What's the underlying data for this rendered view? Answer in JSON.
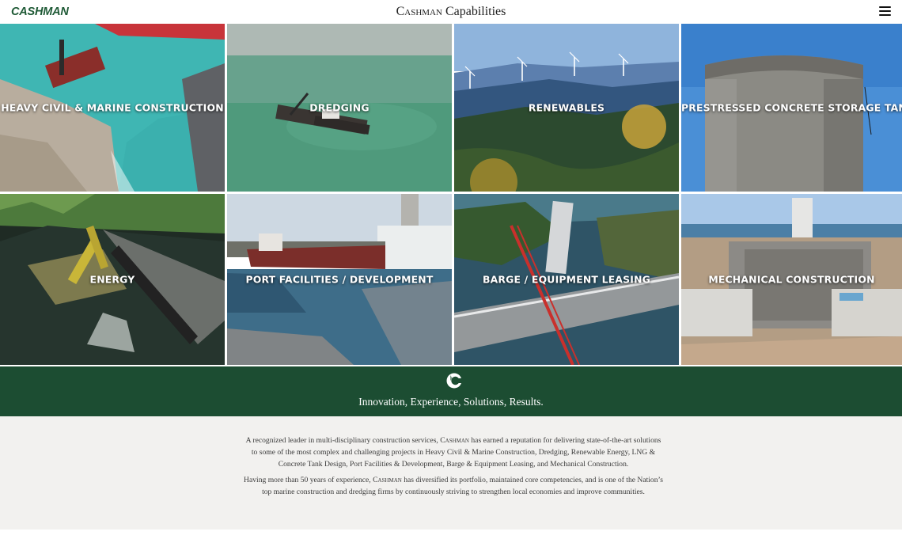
{
  "header": {
    "logo_text": "CASHMAN",
    "title_brand": "Cashman",
    "title_rest": " Capabilities",
    "menu_icon": "hamburger-menu-icon"
  },
  "tiles": [
    {
      "label": "HEAVY CIVIL & MARINE CONSTRUCTION"
    },
    {
      "label": "DREDGING"
    },
    {
      "label": "RENEWABLES"
    },
    {
      "label": "PRESTRESSED CONCRETE STORAGE TANKS"
    },
    {
      "label": "ENERGY"
    },
    {
      "label": "PORT FACILITIES / DEVELOPMENT"
    },
    {
      "label": "BARGE / EQUIPMENT LEASING"
    },
    {
      "label": "MECHANICAL CONSTRUCTION"
    }
  ],
  "band": {
    "icon": "cashman-c-logo-icon",
    "slogan": "Innovation, Experience, Solutions, Results."
  },
  "about": {
    "p1_start": "A recognized leader in multi-disciplinary construction services, ",
    "p1_brand": "Cashman",
    "p1_rest": " has earned a reputation for delivering state-of-the-art solutions to some of the most complex and challenging projects in Heavy Civil & Marine Construction, Dredging, Renewable Energy, LNG & Concrete Tank Design, Port Facilities & Development, Barge & Equipment Leasing, and Mechanical Construction.",
    "p2_start": "Having more than 50 years of experience, ",
    "p2_brand": "Cashman",
    "p2_rest": " has diversified its portfolio, maintained core competencies, and is one of the Nation’s top marine construction and dredging firms by continuously striving to strengthen local economies and improve communities."
  },
  "colors": {
    "brand_green": "#1c4d32",
    "about_bg": "#f2f1ef"
  }
}
